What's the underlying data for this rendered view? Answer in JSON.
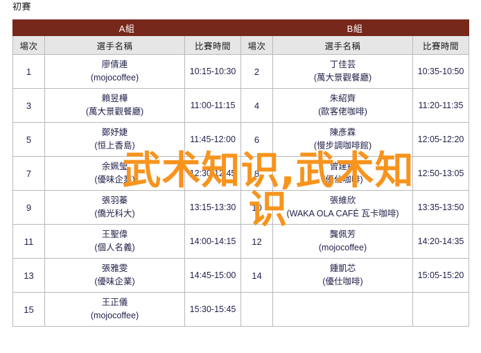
{
  "page": {
    "title": "初賽"
  },
  "watermark": {
    "text": "武术知识,武术知识",
    "color": "#F7941E"
  },
  "table": {
    "group_headers": [
      {
        "label": "A組",
        "colspan": 3
      },
      {
        "label": "B組",
        "colspan": 3
      }
    ],
    "column_headers": [
      "場次",
      "選手名稱",
      "比賽時間",
      "場次",
      "選手名稱",
      "比賽時間"
    ],
    "header_bg": "#76281A",
    "subheader_bg": "#E6E6E6",
    "rows": [
      {
        "a": {
          "no": "1",
          "name": "廖倩連",
          "venue": "(mojocoffee)",
          "time": "10:15-10:30"
        },
        "b": {
          "no": "2",
          "name": "丁佳芸",
          "venue": "(萬大景觀餐廳)",
          "time": "10:35-10:50"
        }
      },
      {
        "a": {
          "no": "3",
          "name": "賴昱樺",
          "venue": "(萬大景觀餐廳)",
          "time": "11:00-11:15"
        },
        "b": {
          "no": "4",
          "name": "朱紹齊",
          "venue": "(歐客佬咖啡)",
          "time": "11:20-11:35"
        }
      },
      {
        "a": {
          "no": "5",
          "name": "鄭妤婕",
          "venue": "(恒上香島)",
          "time": "11:45-12:00"
        },
        "b": {
          "no": "6",
          "name": "陳彥霖",
          "venue": "(慢步調咖啡館)",
          "time": "12:05-12:20"
        }
      },
      {
        "a": {
          "no": "7",
          "name": "余姵瑩",
          "venue": "(優味企業)",
          "time": "12:30-12:45"
        },
        "b": {
          "no": "8",
          "name": "曾建銘",
          "venue": "(優仕咖啡)",
          "time": "12:50-13:05"
        }
      },
      {
        "a": {
          "no": "9",
          "name": "張羽蓁",
          "venue": "(僑光科大)",
          "time": "13:15-13:30"
        },
        "b": {
          "no": "10",
          "name": "張維欣",
          "venue": "(WAKA OLA CAFÉ 瓦卡咖啡)",
          "time": "13:35-13:50"
        }
      },
      {
        "a": {
          "no": "11",
          "name": "王聖偉",
          "venue": "(個人名義)",
          "time": "14:00-14:15"
        },
        "b": {
          "no": "12",
          "name": "龔佩芳",
          "venue": "(mojocoffee)",
          "time": "14:20-14:35"
        }
      },
      {
        "a": {
          "no": "13",
          "name": "張雅雯",
          "venue": "(優味企業)",
          "time": "14:45-15:00"
        },
        "b": {
          "no": "14",
          "name": "鍾凱芯",
          "venue": "(優仕咖啡)",
          "time": "15:05-15:20"
        }
      },
      {
        "a": {
          "no": "15",
          "name": "王正儀",
          "venue": "(mojocoffee)",
          "time": "15:30-15:45"
        },
        "b": {
          "no": "",
          "name": "",
          "venue": "",
          "time": ""
        }
      }
    ]
  }
}
